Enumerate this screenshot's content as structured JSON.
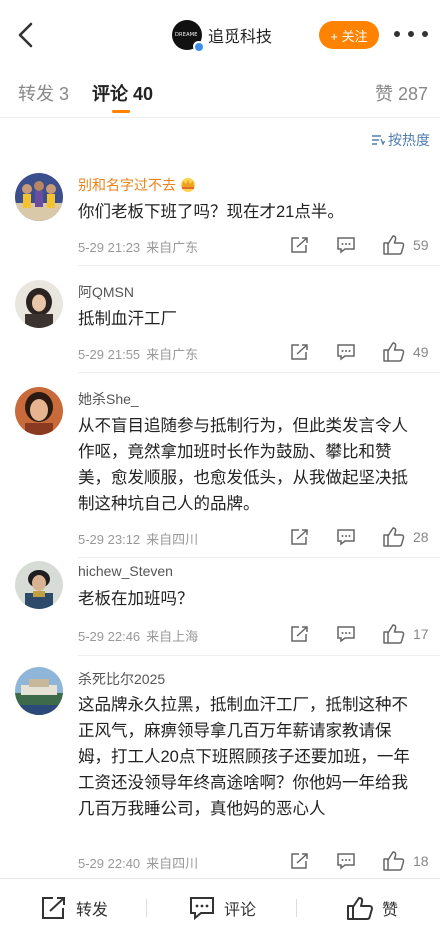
{
  "header": {
    "brand_logo_text": "DREAME",
    "account_name": "追觅科技",
    "follow_label": "+ 关注"
  },
  "tabs": {
    "repost": "转发 3",
    "comment": "评论 40",
    "like": "赞 287"
  },
  "sort": {
    "label": "按热度"
  },
  "comments": [
    {
      "user": "别和名字过不去",
      "text": "你们老板下班了吗？现在才21点半。",
      "date": "5-29 21:23",
      "location": "来自广东",
      "likes": "59"
    },
    {
      "user": "阿QMSN",
      "text": "抵制血汗工厂",
      "date": "5-29 21:55",
      "location": "来自广东",
      "likes": "49"
    },
    {
      "user": "她杀She_",
      "text": "从不盲目追随参与抵制行为，但此类发言令人作呕，竟然拿加班时长作为鼓励、攀比和赞美，愈发顺服，也愈发低头，从我做起坚决抵制这种坑自己人的品牌。",
      "date": "5-29 23:12",
      "location": "来自四川",
      "likes": "28"
    },
    {
      "user": "hichew_Steven",
      "text": "老板在加班吗？",
      "date": "5-29 22:46",
      "location": "来自上海",
      "likes": "17"
    },
    {
      "user": "杀死比尔2025",
      "text": "这品牌永久拉黑，抵制血汗工厂，抵制这种不正风气，麻痹领导拿几百万年薪请家教请保姆，打工人20点下班照顾孩子还要加班，一年工资还没领导年终高途啥啊？你他妈一年给我几百万我睡公司，真他妈的恶心人",
      "date": "5-29 22:40",
      "location": "来自四川",
      "likes": "18"
    }
  ],
  "bottom": {
    "repost": "转发",
    "comment": "评论",
    "like": "赞"
  },
  "colors": {
    "accent": "#ff8200",
    "link": "#507daf",
    "vip_name": "#e8841b"
  },
  "icons": [
    "back-arrow-icon",
    "verified-badge-icon",
    "more-icon",
    "sort-icon",
    "crown-icon",
    "share-icon",
    "reply-icon",
    "thumb-up-icon"
  ]
}
